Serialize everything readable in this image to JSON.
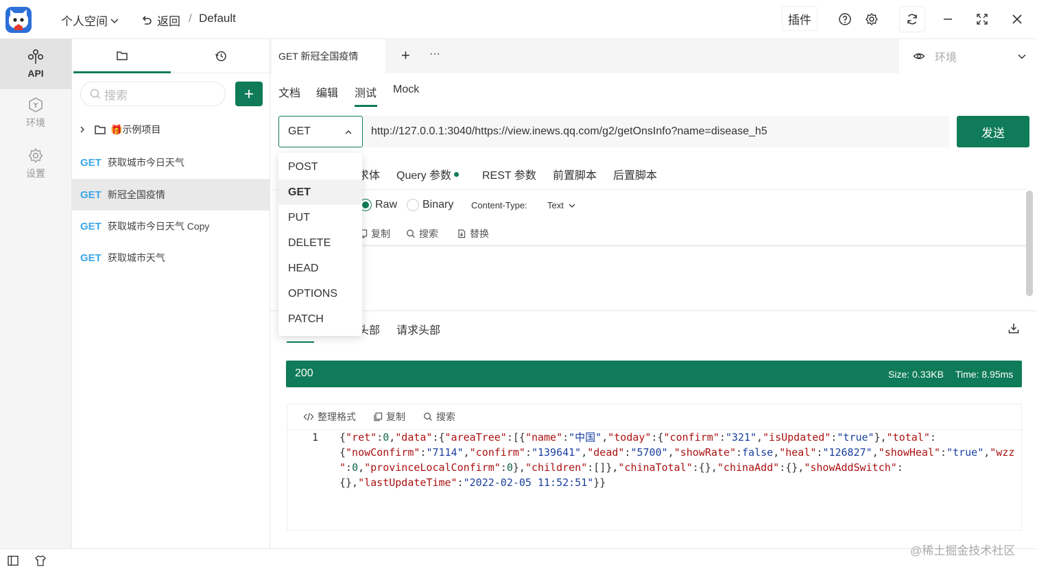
{
  "app": {
    "workspace": "个人空间",
    "back": "返回",
    "crumb_sep": "/",
    "project": "Default",
    "plugin": "插件"
  },
  "rail": [
    {
      "label": "API",
      "icon": "api-icon"
    },
    {
      "label": "环境",
      "icon": "environment-icon"
    },
    {
      "label": "设置",
      "icon": "settings-icon"
    }
  ],
  "sidebar": {
    "search_placeholder": "搜索",
    "folder": "🎁示例项目",
    "apis": [
      {
        "method": "GET",
        "name": "获取城市今日天气"
      },
      {
        "method": "GET",
        "name": "新冠全国疫情"
      },
      {
        "method": "GET",
        "name": "获取城市今日天气 Copy"
      },
      {
        "method": "GET",
        "name": "获取城市天气"
      }
    ]
  },
  "tab": {
    "title": "GET 新冠全国疫情",
    "add": "+",
    "more": "···"
  },
  "env": {
    "placeholder": "环境"
  },
  "subtabs": [
    "文档",
    "编辑",
    "测试",
    "Mock"
  ],
  "request": {
    "method": "GET",
    "url": "http://127.0.0.1:3040/https://view.inews.qq.com/g2/getOnsInfo?name=disease_h5",
    "send": "发送",
    "method_options": [
      "POST",
      "GET",
      "PUT",
      "DELETE",
      "HEAD",
      "OPTIONS",
      "PATCH"
    ],
    "param_tabs": [
      "求体",
      "Query 参数",
      "REST 参数",
      "前置脚本",
      "后置脚本"
    ],
    "body_types": [
      "Raw",
      "Binary"
    ],
    "content_type_label": "Content-Type:",
    "content_type_value": "Text",
    "tools": [
      "复制",
      "搜索",
      "替换"
    ]
  },
  "response": {
    "tabs": [
      "头部",
      "请求头部"
    ],
    "status": "200",
    "size": "Size: 0.33KB",
    "time": "Time: 8.95ms",
    "tools": [
      "整理格式",
      "复制",
      "搜索"
    ],
    "line_no": "1"
  },
  "watermark": "@稀土掘金技术社区",
  "colors": {
    "primary": "#0f7b58",
    "method": "#3ba6e6"
  }
}
